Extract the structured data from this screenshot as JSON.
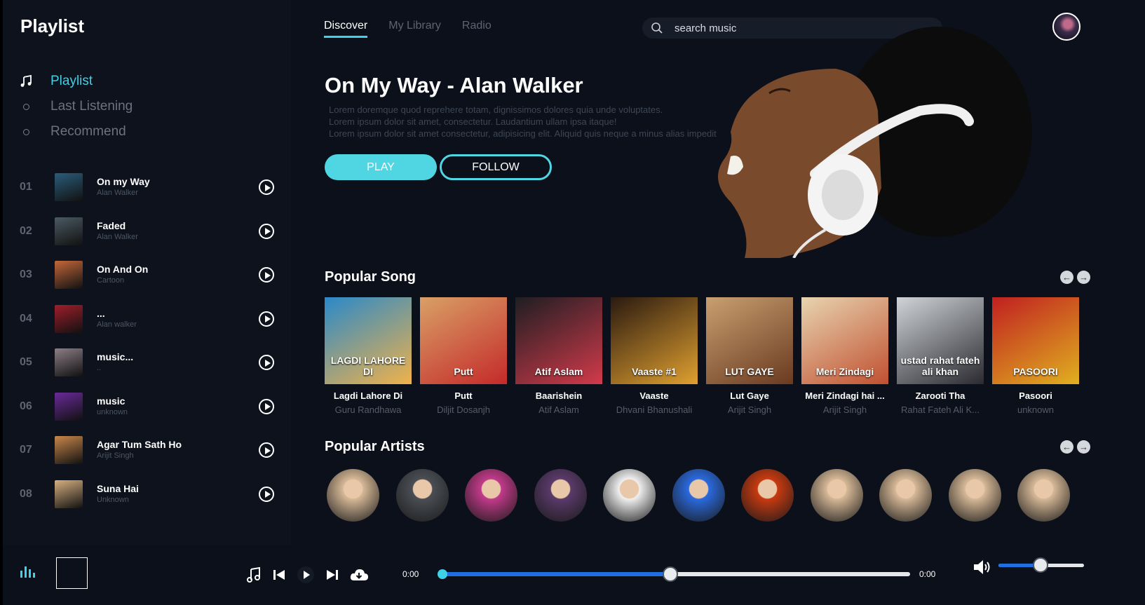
{
  "app": {
    "title": "Playlist"
  },
  "nav": [
    {
      "label": "Playlist",
      "icon": "music-note-icon",
      "active": true
    },
    {
      "label": "Last Listening",
      "icon": "dot-icon",
      "active": false
    },
    {
      "label": "Recommend",
      "icon": "dot-icon",
      "active": false
    }
  ],
  "playlist": [
    {
      "num": "01",
      "title": "On my Way",
      "artist": "Alan Walker",
      "color": "#2b5d7a"
    },
    {
      "num": "02",
      "title": "Faded",
      "artist": "Alan Walker",
      "color": "#4b5a62"
    },
    {
      "num": "03",
      "title": "On And On",
      "artist": "Cartoon",
      "color": "#c4673a"
    },
    {
      "num": "04",
      "title": "...",
      "artist": "Alan walker",
      "color": "#a01e2a"
    },
    {
      "num": "05",
      "title": "music...",
      "artist": "..",
      "color": "#8d7e86"
    },
    {
      "num": "06",
      "title": "music",
      "artist": "unknown",
      "color": "#6a2a9a"
    },
    {
      "num": "07",
      "title": "Agar Tum Sath Ho",
      "artist": "Arijit Singh",
      "color": "#c9874a"
    },
    {
      "num": "08",
      "title": "Suna Hai",
      "artist": "Unknown",
      "color": "#d8b080"
    }
  ],
  "topnav": {
    "tabs": [
      {
        "label": "Discover",
        "active": true
      },
      {
        "label": "My Library",
        "active": false
      },
      {
        "label": "Radio",
        "active": false
      }
    ],
    "search_placeholder": "search music"
  },
  "hero": {
    "title": "On My Way - Alan Walker",
    "desc": [
      "Lorem doremque quod reprehere totam, dignissimos dolores quia unde voluptates.",
      "Lorem ipsum dolor sit amet, consectetur. Laudantium ullam ipsa itaque!",
      "Lorem ipsum dolor sit amet consectetur, adipisicing elit. Aliquid quis neque a minus alias impedit"
    ],
    "play_label": "PLAY",
    "follow_label": "FOLLOW"
  },
  "popular_songs": {
    "title": "Popular Song",
    "items": [
      {
        "title": "Lagdi Lahore Di",
        "artist": "Guru Randhawa",
        "cover_text": "LAGDI LAHORE DI",
        "c1": "#2a89c9",
        "c2": "#f0b24a"
      },
      {
        "title": "Putt",
        "artist": "Diljit Dosanjh",
        "cover_text": "Putt",
        "c1": "#d9a066",
        "c2": "#c42a2a"
      },
      {
        "title": "Baarishein",
        "artist": "Atif Aslam",
        "cover_text": "Atif Aslam",
        "c1": "#1e1e22",
        "c2": "#d23a4a"
      },
      {
        "title": "Vaaste",
        "artist": "Dhvani Bhanushali",
        "cover_text": "Vaaste #1",
        "c1": "#2a1a10",
        "c2": "#e0a030"
      },
      {
        "title": "Lut Gaye",
        "artist": "Arijit Singh",
        "cover_text": "LUT GAYE",
        "c1": "#c8a070",
        "c2": "#6a3a20"
      },
      {
        "title": "Meri Zindagi hai ...",
        "artist": "Arijit Singh",
        "cover_text": "Meri Zindagi",
        "c1": "#e8d4b0",
        "c2": "#c05030"
      },
      {
        "title": "Zarooti Tha",
        "artist": "Rahat Fateh Ali K...",
        "cover_text": "ustad rahat fateh ali khan",
        "c1": "#d0d4d8",
        "c2": "#2a2a30"
      },
      {
        "title": "Pasoori",
        "artist": "unknown",
        "cover_text": "PASOORI",
        "c1": "#c02020",
        "c2": "#e0b020"
      }
    ]
  },
  "popular_artists": {
    "title": "Popular Artists",
    "items": [
      {
        "color": "#d6b896"
      },
      {
        "color": "#4a4e54"
      },
      {
        "color": "#c23a8a"
      },
      {
        "color": "#5a3a6a"
      },
      {
        "color": "#f0f0f0"
      },
      {
        "color": "#2a6adf"
      },
      {
        "color": "#c83a10"
      },
      {
        "color": "#d6b896"
      },
      {
        "color": "#d6b896"
      },
      {
        "color": "#d6b896"
      },
      {
        "color": "#d6b896"
      }
    ]
  },
  "player": {
    "time_current": "0:00",
    "time_total": "0:00",
    "progress": 0.49,
    "volume": 0.49
  },
  "colors": {
    "accent": "#3fd2e6",
    "seek": "#1f6fe0",
    "bg": "#0b101a"
  }
}
